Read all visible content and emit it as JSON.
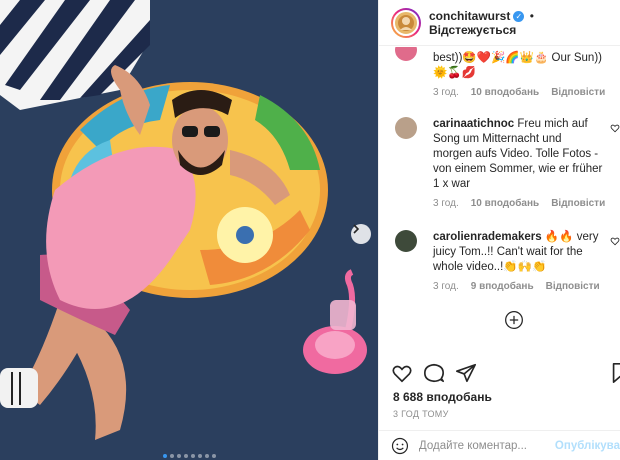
{
  "post": {
    "username": "conchitawurst",
    "follow_label": "Відстежується",
    "separator": "•",
    "likes": "8 688 вподобань",
    "timestamp": "3 ГОД ТОМУ"
  },
  "comments": [
    {
      "username": "",
      "text": "best))🤩❤️🎉🌈👑🎂 Our Sun))🌞🍒💋",
      "time": "3 год.",
      "likes": "10 вподобань",
      "reply": "Відповісти"
    },
    {
      "username": "carinaatichnoc",
      "text": "Freu mich auf Song um Mitternacht und morgen aufs Video. Tolle Fotos - von einem Sommer, wie er früher 1 x war",
      "time": "3 год.",
      "likes": "10 вподобань",
      "reply": "Відповісти"
    },
    {
      "username": "carolienrademakers",
      "text": "🔥🔥 very juicy Tom..!! Can't wait for the whole video..!👏🙌👏",
      "time": "3 год.",
      "likes": "9 вподобань",
      "reply": "Відповісти"
    }
  ],
  "add_comment": {
    "placeholder": "Додайте коментар...",
    "post_label": "Опублікува"
  },
  "icons": {
    "verified": "verified-badge-icon",
    "heart": "heart-icon",
    "comment": "comment-bubble-icon",
    "share": "paper-plane-icon",
    "save": "bookmark-icon",
    "emoji": "smiley-icon",
    "more": "plus-circle-icon",
    "next": "chevron-right-icon"
  },
  "colors": {
    "accent": "#3897f0",
    "muted": "#8e8e8e",
    "post_disabled": "#b2dffc",
    "pool": "#2b3f5e",
    "shirt": "#f39ab7"
  },
  "carousel": {
    "slides": 8,
    "active_index": 0
  }
}
